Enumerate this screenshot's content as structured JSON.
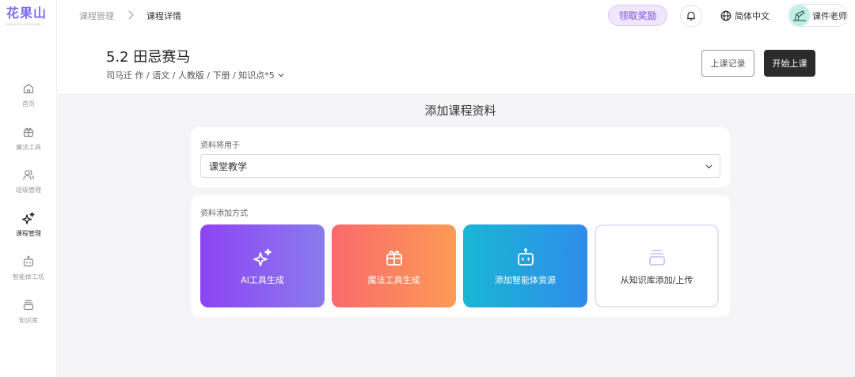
{
  "logo": {
    "main": "花果山",
    "sub": "HUAGUOSHAN"
  },
  "sidebar": {
    "items": [
      {
        "label": "首页",
        "icon": "home-icon",
        "active": false
      },
      {
        "label": "魔法工具",
        "icon": "gift-icon",
        "active": false
      },
      {
        "label": "班级管理",
        "icon": "users-icon",
        "active": false
      },
      {
        "label": "课程管理",
        "icon": "sparkle-icon",
        "active": true
      },
      {
        "label": "智能体工坊",
        "icon": "robot-icon",
        "active": false
      },
      {
        "label": "知识库",
        "icon": "stack-icon",
        "active": false
      }
    ]
  },
  "breadcrumb": {
    "parent": "课程管理",
    "current": "课程详情"
  },
  "header": {
    "reward_label": "领取奖励",
    "language_label": "简体中文",
    "user_name": "课件老师"
  },
  "course": {
    "title": "5.2 田忌赛马",
    "meta": "司马迁 作 / 语文 / 人教版 / 下册 / 知识点*5",
    "record_label": "上课记录",
    "start_label": "开始上课"
  },
  "main": {
    "title": "添加课程资料",
    "usage": {
      "label": "资料将用于",
      "selected": "课堂教学"
    },
    "methods": {
      "label": "资料添加方式",
      "tiles": [
        {
          "label": "AI工具生成",
          "icon": "sparkle-icon"
        },
        {
          "label": "魔法工具生成",
          "icon": "gift-icon"
        },
        {
          "label": "添加智能体资源",
          "icon": "robot-icon"
        },
        {
          "label": "从知识库添加/上传",
          "icon": "stack-icon"
        }
      ]
    }
  },
  "colors": {
    "accent": "#7a4ee8",
    "primary_button": "#2b2b2b",
    "page_background": "#f5f5f7"
  }
}
